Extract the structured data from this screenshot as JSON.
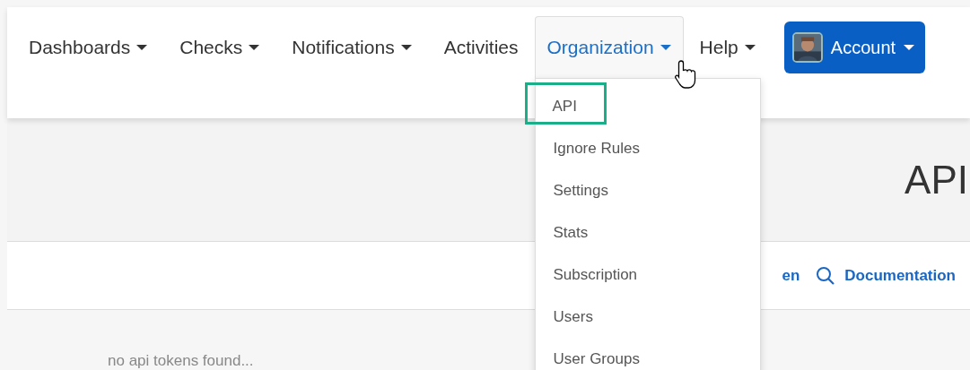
{
  "navbar": {
    "items": [
      {
        "label": "Dashboards",
        "dropdown": true,
        "open": false
      },
      {
        "label": "Checks",
        "dropdown": true,
        "open": false
      },
      {
        "label": "Notifications",
        "dropdown": true,
        "open": false
      },
      {
        "label": "Activities",
        "dropdown": false,
        "open": false
      },
      {
        "label": "Organization",
        "dropdown": true,
        "open": true
      },
      {
        "label": "Help",
        "dropdown": true,
        "open": false
      }
    ],
    "account": {
      "label": "Account"
    }
  },
  "dropdown": {
    "items": [
      {
        "label": "API",
        "selected": true
      },
      {
        "label": "Ignore Rules",
        "selected": false
      },
      {
        "label": "Settings",
        "selected": false
      },
      {
        "label": "Stats",
        "selected": false
      },
      {
        "label": "Subscription",
        "selected": false
      },
      {
        "label": "Users",
        "selected": false
      },
      {
        "label": "User Groups",
        "selected": false
      }
    ]
  },
  "page": {
    "title": "API",
    "toolbar": [
      {
        "label": "en",
        "kind": "plain"
      },
      {
        "label": "Documentation",
        "kind": "search"
      }
    ],
    "empty_message": "no api tokens found..."
  }
}
